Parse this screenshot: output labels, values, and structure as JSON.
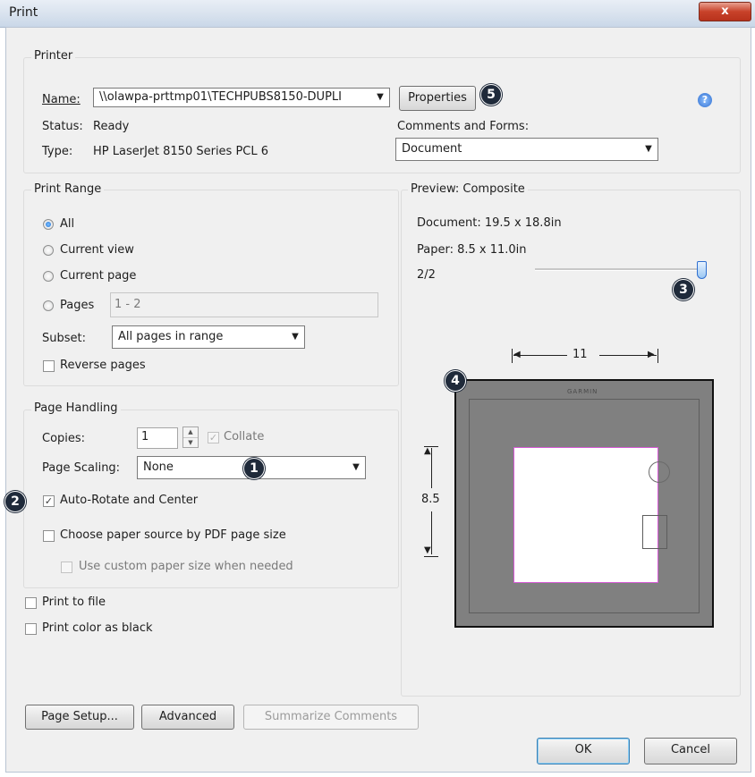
{
  "window": {
    "title": "Print",
    "close_glyph": "x"
  },
  "printer": {
    "group_label": "Printer",
    "name_label": "Name:",
    "name_value": "\\\\olawpa-prttmp01\\TECHPUBS8150-DUPLI",
    "properties_label": "Properties",
    "status_label": "Status:",
    "status_value": "Ready",
    "type_label": "Type:",
    "type_value": "HP LaserJet 8150 Series PCL 6",
    "comments_label": "Comments and Forms:",
    "comments_value": "Document",
    "help_glyph": "?"
  },
  "print_range": {
    "group_label": "Print Range",
    "options": [
      "All",
      "Current view",
      "Current page",
      "Pages"
    ],
    "selected": "All",
    "pages_value": "1 - 2",
    "subset_label": "Subset:",
    "subset_value": "All pages in range",
    "reverse_label": "Reverse pages",
    "reverse_checked": false
  },
  "page_handling": {
    "group_label": "Page Handling",
    "copies_label": "Copies:",
    "copies_value": "1",
    "collate_label": "Collate",
    "scaling_label": "Page Scaling:",
    "scaling_value": "None",
    "autorotate_label": "Auto-Rotate and Center",
    "autorotate_checked": true,
    "paper_source_label": "Choose paper source by PDF page size",
    "custom_paper_label": "Use custom paper size when needed"
  },
  "output": {
    "print_to_file_label": "Print to file",
    "print_color_black_label": "Print color as black"
  },
  "preview": {
    "group_label": "Preview: Composite",
    "document_size": "Document: 19.5 x 18.8in",
    "paper_size": "Paper: 8.5 x 11.0in",
    "page_counter": "2/2",
    "page_position_fraction": 1.0,
    "width_dim": "11",
    "height_dim": "8.5",
    "sheet_brand": "GARMIN"
  },
  "buttons": {
    "page_setup": "Page Setup...",
    "advanced": "Advanced",
    "summarize": "Summarize Comments",
    "ok": "OK",
    "cancel": "Cancel"
  },
  "callouts": [
    "1",
    "2",
    "3",
    "4",
    "5"
  ],
  "colors": {
    "callout_bg": "#1f2a3a",
    "page_area_border": "#d65ad6",
    "preview_sheet": "#808080"
  }
}
